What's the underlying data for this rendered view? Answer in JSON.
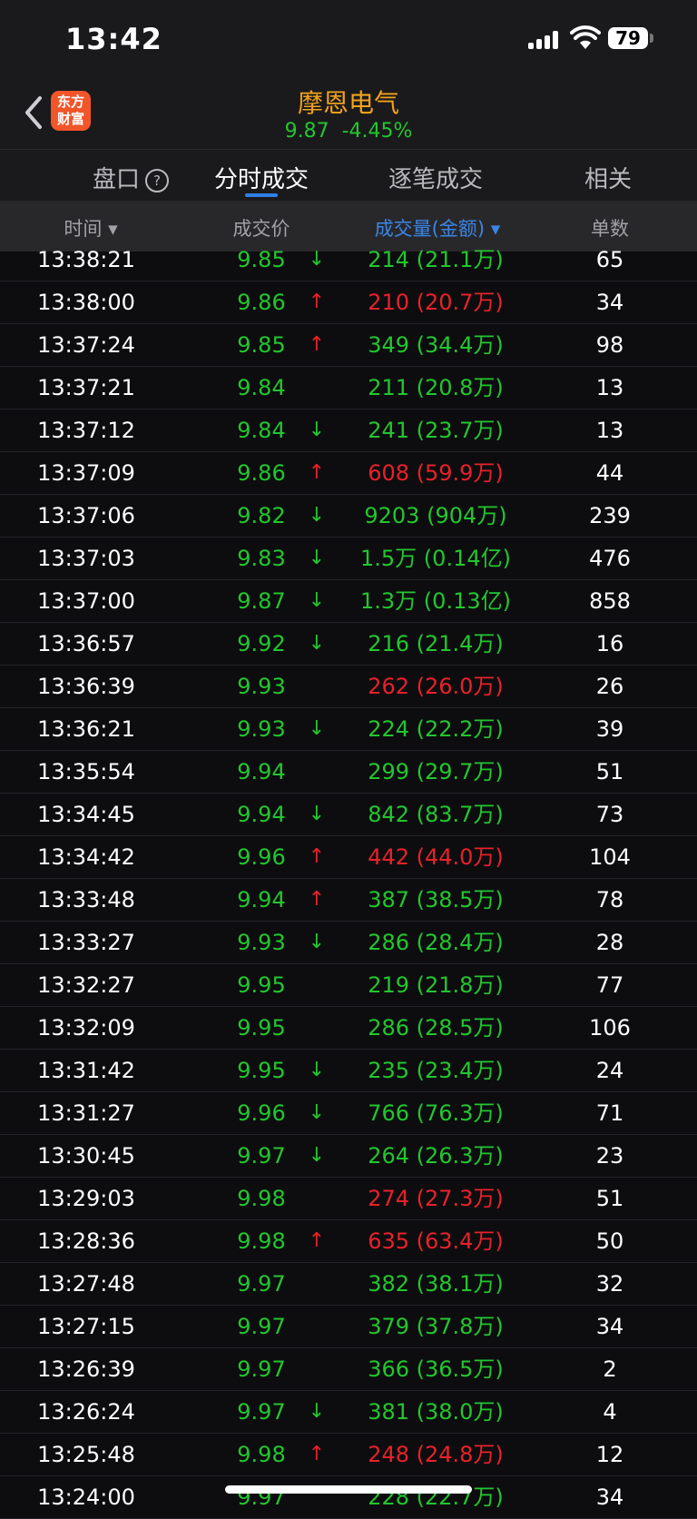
{
  "status": {
    "time": "13:42",
    "battery": "79"
  },
  "header": {
    "logo_line1": "东方",
    "logo_line2": "财富",
    "name": "摩恩电气",
    "price": "9.87",
    "change": "-4.45%"
  },
  "tabs": [
    "盘口",
    "分时成交",
    "逐笔成交",
    "相关"
  ],
  "help_glyph": "?",
  "columns": {
    "time": "时间",
    "price": "成交价",
    "volume": "成交量(金额)",
    "count": "单数"
  },
  "colors": {
    "up": "#e8212b",
    "down": "#23c62f",
    "accent": "#3a86e6",
    "name": "#f1a21b"
  },
  "trades": [
    {
      "time": "13:38:21",
      "price": "9.85",
      "arrow": "↓",
      "volume": "214 (21.1万)",
      "vol_color": "green",
      "count": "65"
    },
    {
      "time": "13:38:00",
      "price": "9.86",
      "arrow": "↑",
      "volume": "210 (20.7万)",
      "vol_color": "red",
      "count": "34"
    },
    {
      "time": "13:37:24",
      "price": "9.85",
      "arrow": "↑",
      "volume": "349 (34.4万)",
      "vol_color": "green",
      "count": "98"
    },
    {
      "time": "13:37:21",
      "price": "9.84",
      "arrow": "",
      "volume": "211 (20.8万)",
      "vol_color": "green",
      "count": "13"
    },
    {
      "time": "13:37:12",
      "price": "9.84",
      "arrow": "↓",
      "volume": "241 (23.7万)",
      "vol_color": "green",
      "count": "13"
    },
    {
      "time": "13:37:09",
      "price": "9.86",
      "arrow": "↑",
      "volume": "608 (59.9万)",
      "vol_color": "red",
      "count": "44"
    },
    {
      "time": "13:37:06",
      "price": "9.82",
      "arrow": "↓",
      "volume": "9203 (904万)",
      "vol_color": "green",
      "count": "239"
    },
    {
      "time": "13:37:03",
      "price": "9.83",
      "arrow": "↓",
      "volume": "1.5万 (0.14亿)",
      "vol_color": "green",
      "count": "476"
    },
    {
      "time": "13:37:00",
      "price": "9.87",
      "arrow": "↓",
      "volume": "1.3万 (0.13亿)",
      "vol_color": "green",
      "count": "858"
    },
    {
      "time": "13:36:57",
      "price": "9.92",
      "arrow": "↓",
      "volume": "216 (21.4万)",
      "vol_color": "green",
      "count": "16"
    },
    {
      "time": "13:36:39",
      "price": "9.93",
      "arrow": "",
      "volume": "262 (26.0万)",
      "vol_color": "red",
      "count": "26"
    },
    {
      "time": "13:36:21",
      "price": "9.93",
      "arrow": "↓",
      "volume": "224 (22.2万)",
      "vol_color": "green",
      "count": "39"
    },
    {
      "time": "13:35:54",
      "price": "9.94",
      "arrow": "",
      "volume": "299 (29.7万)",
      "vol_color": "green",
      "count": "51"
    },
    {
      "time": "13:34:45",
      "price": "9.94",
      "arrow": "↓",
      "volume": "842 (83.7万)",
      "vol_color": "green",
      "count": "73"
    },
    {
      "time": "13:34:42",
      "price": "9.96",
      "arrow": "↑",
      "volume": "442 (44.0万)",
      "vol_color": "red",
      "count": "104"
    },
    {
      "time": "13:33:48",
      "price": "9.94",
      "arrow": "↑",
      "volume": "387 (38.5万)",
      "vol_color": "green",
      "count": "78"
    },
    {
      "time": "13:33:27",
      "price": "9.93",
      "arrow": "↓",
      "volume": "286 (28.4万)",
      "vol_color": "green",
      "count": "28"
    },
    {
      "time": "13:32:27",
      "price": "9.95",
      "arrow": "",
      "volume": "219 (21.8万)",
      "vol_color": "green",
      "count": "77"
    },
    {
      "time": "13:32:09",
      "price": "9.95",
      "arrow": "",
      "volume": "286 (28.5万)",
      "vol_color": "green",
      "count": "106"
    },
    {
      "time": "13:31:42",
      "price": "9.95",
      "arrow": "↓",
      "volume": "235 (23.4万)",
      "vol_color": "green",
      "count": "24"
    },
    {
      "time": "13:31:27",
      "price": "9.96",
      "arrow": "↓",
      "volume": "766 (76.3万)",
      "vol_color": "green",
      "count": "71"
    },
    {
      "time": "13:30:45",
      "price": "9.97",
      "arrow": "↓",
      "volume": "264 (26.3万)",
      "vol_color": "green",
      "count": "23"
    },
    {
      "time": "13:29:03",
      "price": "9.98",
      "arrow": "",
      "volume": "274 (27.3万)",
      "vol_color": "red",
      "count": "51"
    },
    {
      "time": "13:28:36",
      "price": "9.98",
      "arrow": "↑",
      "volume": "635 (63.4万)",
      "vol_color": "red",
      "count": "50"
    },
    {
      "time": "13:27:48",
      "price": "9.97",
      "arrow": "",
      "volume": "382 (38.1万)",
      "vol_color": "green",
      "count": "32"
    },
    {
      "time": "13:27:15",
      "price": "9.97",
      "arrow": "",
      "volume": "379 (37.8万)",
      "vol_color": "green",
      "count": "34"
    },
    {
      "time": "13:26:39",
      "price": "9.97",
      "arrow": "",
      "volume": "366 (36.5万)",
      "vol_color": "green",
      "count": "2"
    },
    {
      "time": "13:26:24",
      "price": "9.97",
      "arrow": "↓",
      "volume": "381 (38.0万)",
      "vol_color": "green",
      "count": "4"
    },
    {
      "time": "13:25:48",
      "price": "9.98",
      "arrow": "↑",
      "volume": "248 (24.8万)",
      "vol_color": "red",
      "count": "12"
    },
    {
      "time": "13:24:00",
      "price": "9.97",
      "arrow": "",
      "volume": "228 (22.7万)",
      "vol_color": "green",
      "count": "34"
    }
  ]
}
